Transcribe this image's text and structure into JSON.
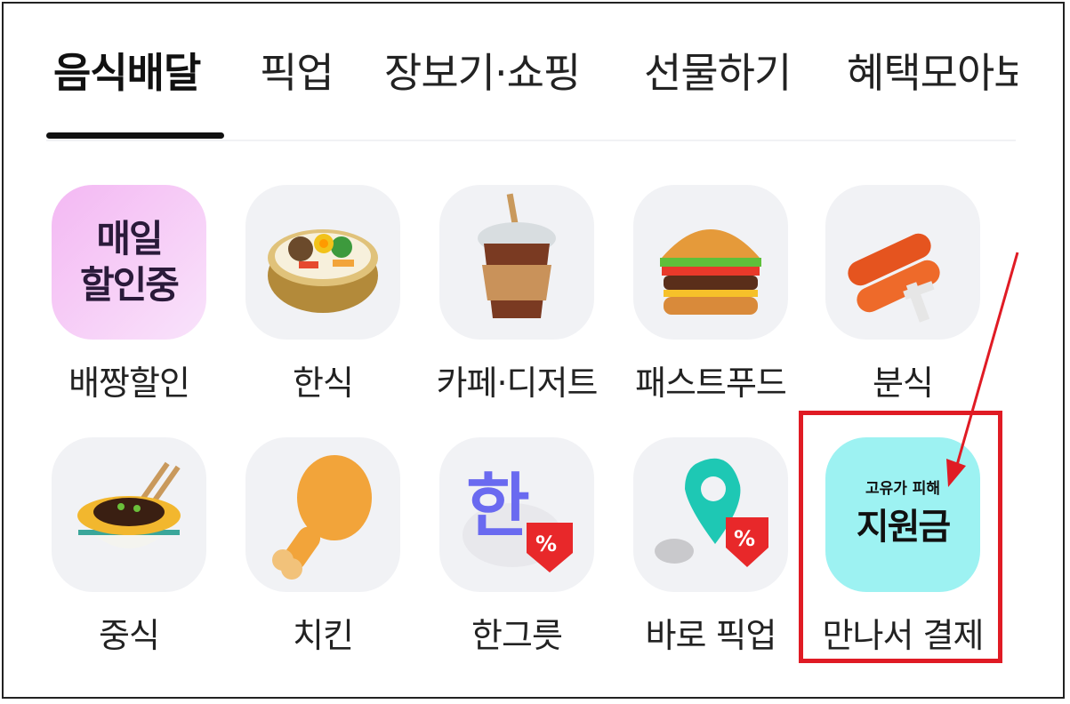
{
  "tabs": [
    {
      "label": "음식배달",
      "active": true
    },
    {
      "label": "픽업",
      "active": false
    },
    {
      "label": "장보기·쇼핑",
      "active": false
    },
    {
      "label": "선물하기",
      "active": false
    },
    {
      "label": "혜택모아보",
      "active": false
    }
  ],
  "categories_row1": [
    {
      "label": "배짱할인",
      "icon": "daily-discount-badge",
      "badge_line1": "매일",
      "badge_line2": "할인중"
    },
    {
      "label": "한식",
      "icon": "bibimbap-icon"
    },
    {
      "label": "카페·디저트",
      "icon": "iced-coffee-icon"
    },
    {
      "label": "패스트푸드",
      "icon": "burger-icon"
    },
    {
      "label": "분식",
      "icon": "tteokbokki-skewer-icon"
    }
  ],
  "categories_row2": [
    {
      "label": "중식",
      "icon": "jajangmyeon-bowl-icon"
    },
    {
      "label": "치킨",
      "icon": "fried-chicken-leg-icon"
    },
    {
      "label": "한그릇",
      "icon": "han-bowl-discount-icon"
    },
    {
      "label": "바로 픽업",
      "icon": "pickup-pin-discount-icon"
    },
    {
      "label": "만나서 결제",
      "icon": "subsidy-badge",
      "badge_line1": "고유가 피해",
      "badge_line2": "지원금"
    }
  ],
  "highlight_color": "#e01b24",
  "discount_symbol": "%"
}
